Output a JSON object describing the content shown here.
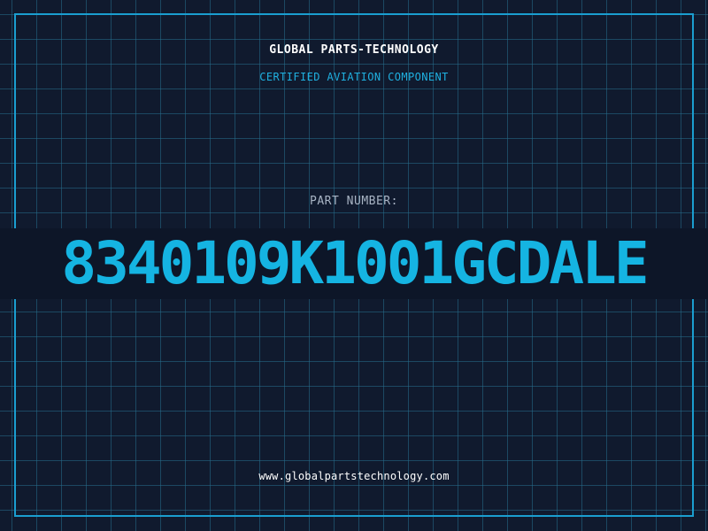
{
  "header": {
    "company": "GLOBAL PARTS-TECHNOLOGY",
    "subtitle": "CERTIFIED AVIATION COMPONENT"
  },
  "part": {
    "label": "PART NUMBER:",
    "number": "8340109K1001GCDALE"
  },
  "footer": {
    "website": "www.globalpartstechnology.com"
  },
  "colors": {
    "background": "#101a2e",
    "grid": "#266e8c",
    "frame": "#1a9ed0",
    "accent": "#15b4e2",
    "text": "#ffffff",
    "label": "#a8b4c4"
  }
}
